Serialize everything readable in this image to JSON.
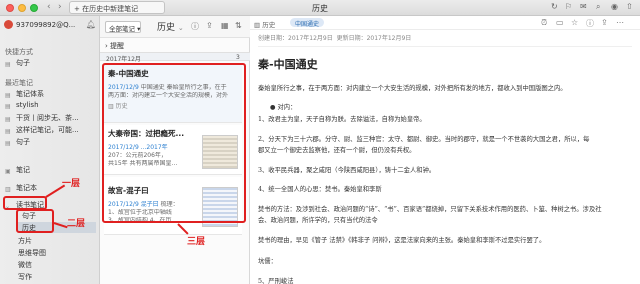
{
  "titlebar": {
    "history_field": "在历史中新建笔记",
    "window_title": "历史"
  },
  "sidebar": {
    "account": "937099892@Q...",
    "shortcuts_header": "快捷方式",
    "shortcut_item": "句子",
    "recent_header": "最近笔记",
    "recent_items": [
      "笔记体系",
      "stylish",
      "干货丨阅步无、茶...",
      "这样记笔记，可能...",
      "句子"
    ],
    "notes": "笔记",
    "notebooks": "笔记本",
    "reading_notebook": "读书笔记",
    "sub_items": [
      "句子",
      "历史"
    ],
    "more_items": [
      "方片",
      "思维导图",
      "微信",
      "写作"
    ]
  },
  "notelist": {
    "all_notes_button": "全部笔记",
    "title": "历史",
    "reminder": "提醒",
    "date_group": "2017年12月",
    "date_count": "3",
    "cards": [
      {
        "title": "秦-中国通史",
        "line1_meta": "2017/12/9",
        "line1_rest": "中国通史  秦始皇所行之事，在于",
        "line2": "两方面：对内建立一个大安全活的规模，对外",
        "tag": "历史"
      },
      {
        "title": "大秦帝国：过把瘾死...",
        "line1": "2017/12/9  ...2017年",
        "line2": "207：公元前206年，",
        "line3": "共15年 共有两属帝国皇..."
      },
      {
        "title": "故宫-混子曰",
        "line1_meta": "2017/12/9  混子曰",
        "line1_rest": "  梳理：",
        "line2": "1、故宫位于北京中轴线",
        "line3": "3、故宫内结构 4、在历"
      }
    ]
  },
  "editor": {
    "notebook": "历史",
    "tag": "中国通史",
    "created": "创建日期：2017年12月9日",
    "updated": "更新日期：2017年12月9日",
    "title": "秦-中国通史",
    "paragraphs": [
      "秦始皇所行之事，在于两方面：对内建立一个大安生活的规模，对外把所有发的地方，都收入到中国版图之内。",
      "● 对内：",
      "1、改君主为皇，天子自称为朕。去除谥法，自称为始皇帝。",
      "2、分天下为三十六郡。分守、尉、监三种官：太守、都尉、御史。当时的郡守，就是一个不世袭的大国之君，所以，每",
      "郡又立一个御史去监察他，还有一个尉，但仍没有兵权。",
      "3、收平民兵器，聚之咸阳（今陕西咸阳县），铸十二金人和钟。",
      "4、统一全国人的心思：焚书。秦始皇和李斯",
      "焚书的方法：及涉到社会、政治问题的“诗”、“书”、百家语”都烧掉，只留下关系技术作用的医药、卜筮、种树之书。涉及社",
      "会、政治问题，所许学的，只有当代的法令",
      "焚书的理由，早见《管子 法禁》《韩非子 问辩》，这是法家向来的主张。秦始皇和李斯不过是实行罢了。",
      "坑儒：",
      "5、严刑峻法"
    ]
  },
  "annotations": {
    "level1": "一层",
    "level2": "二层",
    "level3": "三层"
  }
}
